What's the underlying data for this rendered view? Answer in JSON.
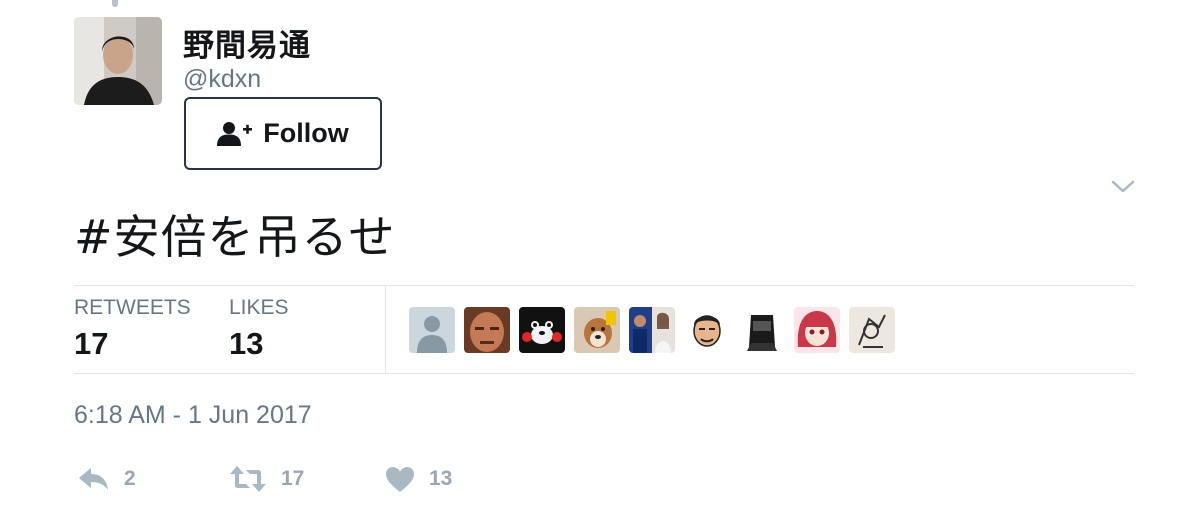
{
  "user": {
    "display_name": "野間易通",
    "handle": "@kdxn"
  },
  "follow_button": {
    "label": "Follow",
    "icon": "add-user-icon"
  },
  "tweet": {
    "text": "#安倍を吊るせ"
  },
  "stats": {
    "retweets_label": "RETWEETS",
    "retweets_value": "17",
    "likes_label": "LIKES",
    "likes_value": "13"
  },
  "likers": [
    {
      "icon": "default-profile-avatar"
    },
    {
      "icon": "face-photo-avatar"
    },
    {
      "icon": "bear-mascot-avatar"
    },
    {
      "icon": "dog-avatar"
    },
    {
      "icon": "photo-collage-avatar"
    },
    {
      "icon": "illustrated-man-avatar"
    },
    {
      "icon": "dark-figure-avatar"
    },
    {
      "icon": "anime-girl-avatar"
    },
    {
      "icon": "sketch-avatar"
    }
  ],
  "timestamp": "6:18 AM - 1 Jun 2017",
  "actions": {
    "reply_count": "2",
    "retweet_count": "17",
    "like_count": "13"
  },
  "colors": {
    "text_primary": "#14171a",
    "text_secondary": "#657786",
    "action_icon": "#aab8c2",
    "divider": "#e1e8ed"
  }
}
